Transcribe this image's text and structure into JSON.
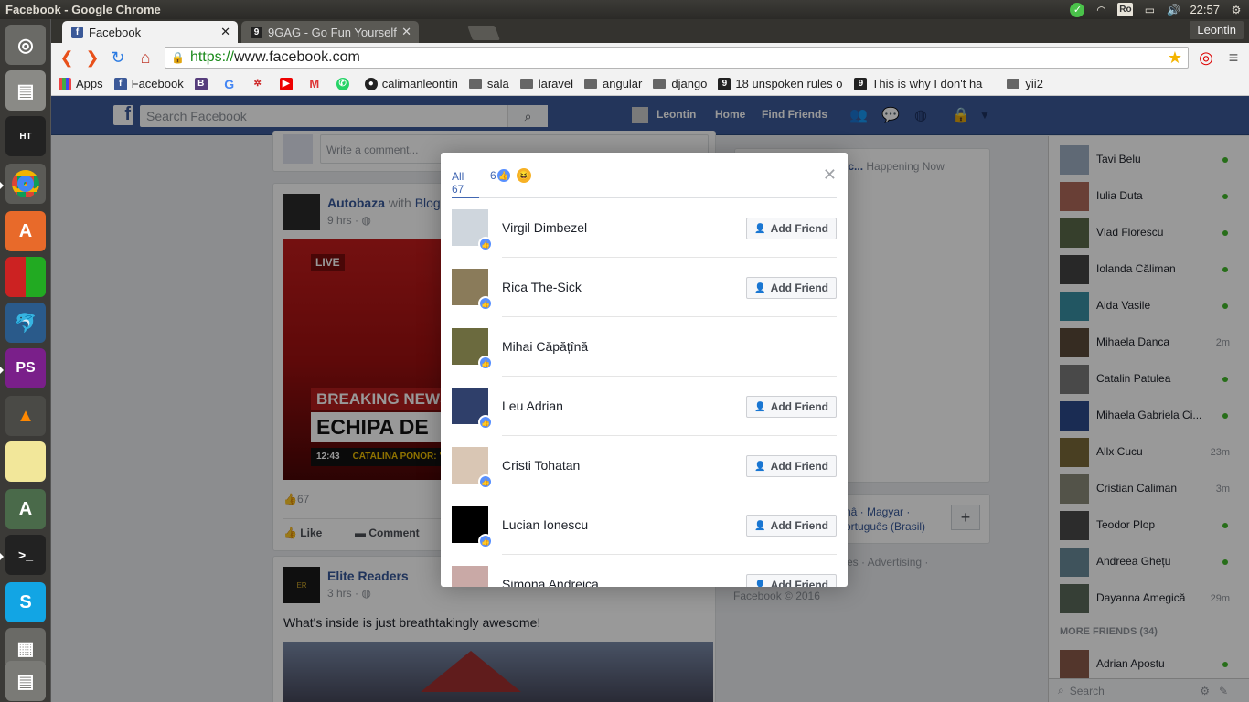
{
  "window_title": "Facebook - Google Chrome",
  "tray": {
    "ro_label": "Ro",
    "clock": "22:57"
  },
  "tabs": [
    {
      "label": "Facebook"
    },
    {
      "label": "9GAG - Go Fun Yourself"
    }
  ],
  "profile_name": "Leontin",
  "address": {
    "scheme": "https://",
    "host": "www.facebook.com"
  },
  "bookmarks": {
    "apps": "Apps",
    "facebook": "Facebook",
    "github": "calimanleontin",
    "sala": "sala",
    "laravel": "laravel",
    "angular": "angular",
    "django": "django",
    "unspoken": "18 unspoken rules o",
    "thisiswhy": "This is why I don't ha",
    "yii2": "yii2"
  },
  "fb": {
    "search_placeholder": "Search Facebook",
    "nav": {
      "user": "Leontin",
      "home": "Home",
      "find_friends": "Find Friends"
    },
    "comment_placeholder": "Write a comment...",
    "post1": {
      "author": "Autobaza",
      "with_text": "with",
      "with_name": "Blog",
      "time": "9 hrs",
      "live": "LIVE",
      "breaking": "BREAKING NEWS",
      "headline": "ECHIPA DE",
      "clock": "12:43",
      "ticker": "CATALINA PONOR: \"N",
      "reactions_count": "67",
      "like": "Like",
      "comment": "Comment"
    },
    "post2": {
      "author": "Elite Readers",
      "time": "3 hrs",
      "text": "What's inside is just breathtakingly awesome!"
    },
    "right_col": {
      "trend_suffix": "esc...",
      "happening": "Happening Now",
      "lang1": "nâ · Magyar ·",
      "lang2": "ortuguês (Brasil)",
      "footer1": "es · Advertising ·",
      "footer2": "Facebook © 2016"
    }
  },
  "dialog": {
    "tab_all": "All 67",
    "tab_like_count": "6",
    "add_friend_label": "Add Friend",
    "people": [
      {
        "name": "Virgil Dimbezel",
        "can_add": true,
        "color": "#cfd6dd"
      },
      {
        "name": "Rica The-Sick",
        "can_add": true,
        "color": "#8a7b5a"
      },
      {
        "name": "Mihai Căpățînă",
        "can_add": false,
        "color": "#6b6a3e"
      },
      {
        "name": "Leu Adrian",
        "can_add": true,
        "color": "#2f3f6a"
      },
      {
        "name": "Cristi Tohatan",
        "can_add": true,
        "color": "#d9c6b4"
      },
      {
        "name": "Lucian Ionescu",
        "can_add": true,
        "color": "#000000"
      },
      {
        "name": "Simona Andreica",
        "can_add": true,
        "color": "#c9a9a6"
      }
    ]
  },
  "chat": {
    "friends": [
      {
        "name": "Tavi Belu",
        "status": "online",
        "time": "",
        "color": "#9fb0c4"
      },
      {
        "name": "Iulia Duta",
        "status": "online",
        "time": "",
        "color": "#b06a5a"
      },
      {
        "name": "Vlad Florescu",
        "status": "online",
        "time": "",
        "color": "#5a6a4a"
      },
      {
        "name": "Iolanda Căliman",
        "status": "online",
        "time": "",
        "color": "#444444"
      },
      {
        "name": "Aida Vasile",
        "status": "online",
        "time": "",
        "color": "#3a8fa4"
      },
      {
        "name": "Mihaela Danca",
        "status": "away",
        "time": "2m",
        "color": "#5a4a3a"
      },
      {
        "name": "Catalin Patulea",
        "status": "online",
        "time": "",
        "color": "#7a7a7a"
      },
      {
        "name": "Mihaela Gabriela Ci...",
        "status": "online",
        "time": "",
        "color": "#2c4a8a"
      },
      {
        "name": "Allx Cucu",
        "status": "away",
        "time": "23m",
        "color": "#7a6a3a"
      },
      {
        "name": "Cristian Caliman",
        "status": "away",
        "time": "3m",
        "color": "#8a8a7a"
      },
      {
        "name": "Teodor Plop",
        "status": "online",
        "time": "",
        "color": "#4a4a4a"
      },
      {
        "name": "Andreea Ghețu",
        "status": "online",
        "time": "",
        "color": "#6a8a9a"
      },
      {
        "name": "Dayanna Amegică",
        "status": "away",
        "time": "29m",
        "color": "#5a6a5a"
      }
    ],
    "more_friends": "MORE FRIENDS (34)",
    "more": [
      {
        "name": "Adrian Apostu",
        "status": "online",
        "color": "#8a5a4a"
      }
    ],
    "search_placeholder": "Search"
  },
  "colors": {
    "fb_blue": "#3b5998",
    "online": "#42b72a",
    "like_blue": "#5890ff"
  }
}
